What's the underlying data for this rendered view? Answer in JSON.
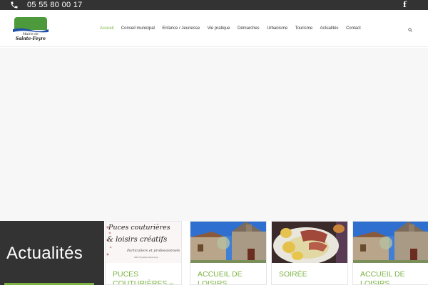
{
  "topbar": {
    "phone": "05 55 80 00 17",
    "phone_icon": "phone-icon",
    "social_icon": "facebook-icon",
    "social_glyph": "f"
  },
  "header": {
    "logo": {
      "line1": "Mairie de",
      "line2": "Sainte-Feyre"
    },
    "nav": [
      {
        "label": "Accueil",
        "active": true
      },
      {
        "label": "Conseil municipal",
        "active": false
      },
      {
        "label": "Enfance / Jeunesse",
        "active": false
      },
      {
        "label": "Vie pratique",
        "active": false
      },
      {
        "label": "Démarches",
        "active": false
      },
      {
        "label": "Urbanisme",
        "active": false
      },
      {
        "label": "Tourisme",
        "active": false
      },
      {
        "label": "Actualités",
        "active": false
      },
      {
        "label": "Contact",
        "active": false
      }
    ],
    "search_icon": "search-icon"
  },
  "news": {
    "section_title": "Actualités",
    "cards": [
      {
        "title": "PUCES COUTURIÈRES –",
        "thumb": {
          "line1": "Puces couturières",
          "line2": "& loisirs créatifs",
          "line3": "Particuliers et professionnels",
          "line4": "Salle Polyvalente Sainte-Feyre"
        }
      },
      {
        "title": "ACCUEIL DE LOISIRS"
      },
      {
        "title": "SOIRÉE"
      },
      {
        "title": "ACCUEIL DE LOISIRS"
      }
    ]
  },
  "colors": {
    "accent": "#7cb342",
    "topbar_bg": "#333333",
    "news_box_bg": "#333333"
  }
}
